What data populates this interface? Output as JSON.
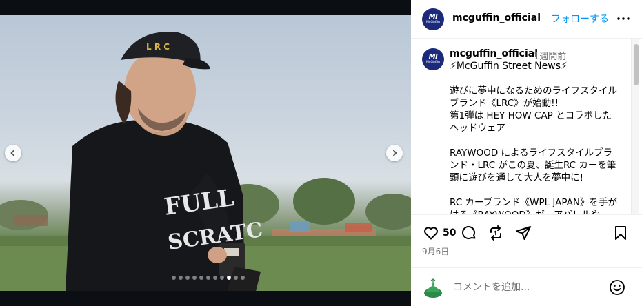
{
  "post": {
    "username": "mcguffin_official",
    "follow_label": "フォローする",
    "avatar_mark": "MI",
    "avatar_wordmark": "McGuffin",
    "accent_color": "#0095f6",
    "brand_color": "#1b2a7a"
  },
  "media": {
    "slide_count": 11,
    "active_slide_index": 8,
    "prev_icon": "chevron-left-icon",
    "next_icon": "chevron-right-icon",
    "cap_text": "L R C",
    "shirt_line1": "FULL",
    "shirt_line2": "SCRATC"
  },
  "caption": {
    "username": "mcguffin_official",
    "time": "1週間前",
    "first_line": "⚡McGuffin Street News⚡",
    "body": "遊びに夢中になるためのライフスタイルブランド《LRC》が始動!!\n第1弾は HEY HOW CAP とコラボしたヘッドウェア\n\nRAYWOOD によるライフスタイルブランド・LRC がこの夏、誕生RC カーを筆頭に遊びを通して大人を夢中に!\n\nRC カーブランド《WPL JAPAN》を手がける《RAYWOOD》が、アパレルや"
  },
  "actions": {
    "like_count": "50",
    "date": "9月6日",
    "icons": [
      "heart-icon",
      "comment-icon",
      "repost-icon",
      "share-icon",
      "bookmark-icon"
    ]
  },
  "comment_box": {
    "placeholder": "コメントを追加...",
    "emoji_icon": "smiley-icon"
  }
}
